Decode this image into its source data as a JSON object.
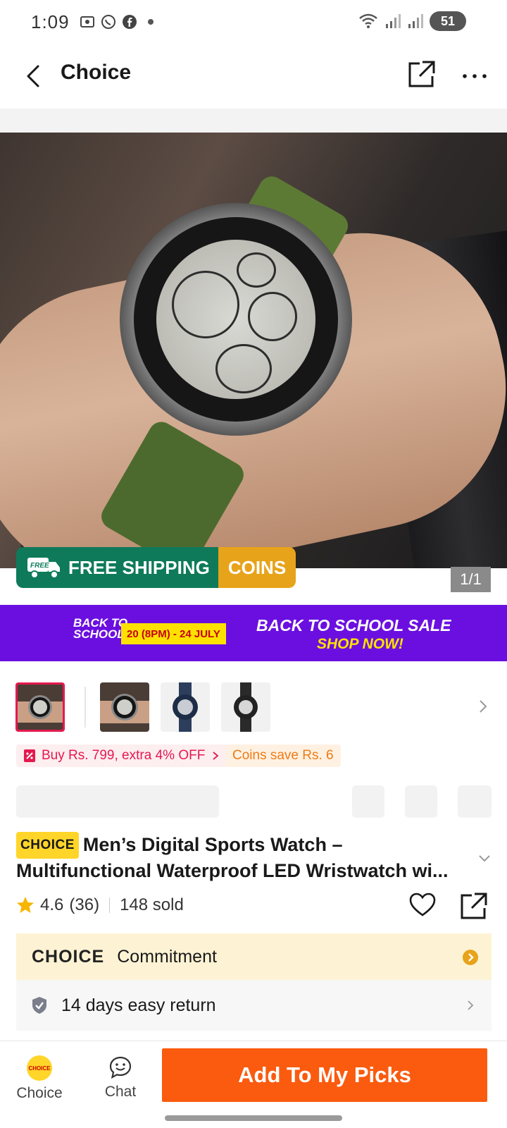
{
  "status_bar": {
    "time": "1:09",
    "battery": "51",
    "icons": [
      "screenshot-icon",
      "whatsapp-icon",
      "facebook-icon",
      "dot-icon",
      "wifi-icon",
      "signal-icon",
      "signal-icon",
      "battery-icon"
    ]
  },
  "header": {
    "title": "Choice",
    "back_icon": "chevron-left-icon",
    "share_icon": "share-icon",
    "more_icon": "more-dots-icon"
  },
  "gallery": {
    "counter": "1/1",
    "promo_free_badge": "FREE",
    "promo_shipping": "FREE SHIPPING",
    "promo_coins": "COINS"
  },
  "sale_banner": {
    "logo_line1": "BACK TO",
    "logo_line2": "SCHOOL",
    "dates": "20 (8PM) - 24 JULY",
    "title": "BACK TO SCHOOL SALE",
    "cta": "SHOP NOW!",
    "bg_color": "#6b0fe0"
  },
  "thumbnails": {
    "count": 4,
    "selected_index": 0,
    "next_icon": "chevron-right-icon"
  },
  "coupons": {
    "discount": "Buy Rs. 799, extra 4% OFF",
    "coins": "Coins save Rs. 6"
  },
  "product": {
    "badge": "CHOICE",
    "title": "Men’s Digital Sports Watch – Multifunctional Waterproof LED Wristwatch wi...",
    "rating": "4.6",
    "reviews": "(36)",
    "sold": "148 sold"
  },
  "commitment": {
    "logo": "CHOICE",
    "label": "Commitment",
    "return_label": "14 days easy return"
  },
  "bottom_bar": {
    "choice_label": "Choice",
    "choice_circle": "CHOICE",
    "chat_label": "Chat",
    "cta_label": "Add To My Picks",
    "cta_color": "#fa5b0f"
  },
  "colors": {
    "accent_red": "#e5194f",
    "choice_yellow": "#ffd529",
    "free_shipping_green": "#0e7a5a",
    "coins_orange": "#e7a31a"
  }
}
